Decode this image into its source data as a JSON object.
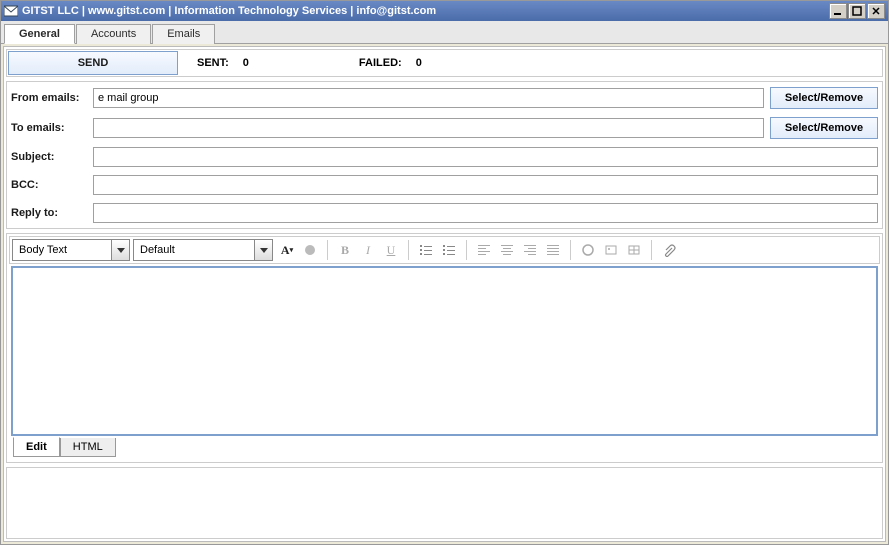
{
  "window": {
    "title": "GITST LLC | www.gitst.com | Information Technology Services | info@gitst.com"
  },
  "tabs": {
    "general": "General",
    "accounts": "Accounts",
    "emails": "Emails"
  },
  "send": {
    "button": "SEND",
    "sent_label": "SENT:",
    "sent_value": "0",
    "failed_label": "FAILED:",
    "failed_value": "0"
  },
  "form": {
    "from_label": "From emails:",
    "from_value": "e mail group",
    "to_label": "To emails:",
    "to_value": "",
    "subject_label": "Subject:",
    "subject_value": "",
    "bcc_label": "BCC:",
    "bcc_value": "",
    "reply_label": "Reply to:",
    "reply_value": "",
    "select_remove": "Select/Remove"
  },
  "editor": {
    "style": "Body Text",
    "font": "Default",
    "tab_edit": "Edit",
    "tab_html": "HTML",
    "body": ""
  },
  "log": ""
}
